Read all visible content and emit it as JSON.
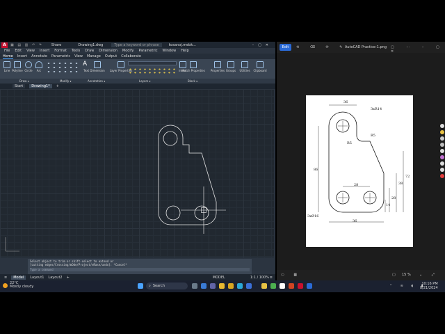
{
  "autocad": {
    "title_items": [
      "Share",
      "Drawing1.dwg",
      "Type a keyword or phrase",
      "kosanoj.mebk..."
    ],
    "menu": [
      "File",
      "Edit",
      "View",
      "Insert",
      "Format",
      "Tools",
      "Draw",
      "Dimension",
      "Modify",
      "Parametric",
      "Window",
      "Help"
    ],
    "ribbon_tabs": [
      "Home",
      "Insert",
      "Annotate",
      "Parametric",
      "View",
      "Manage",
      "Output",
      "Collaborate"
    ],
    "tools": [
      {
        "label": "Line",
        "icon": "line-icon"
      },
      {
        "label": "Polyline",
        "icon": "polyline-icon"
      },
      {
        "label": "Circle",
        "icon": "circle-icon"
      },
      {
        "label": "Arc",
        "icon": "arc-icon"
      },
      {
        "label": "Text",
        "icon": "text-icon"
      },
      {
        "label": "Dimension",
        "icon": "dimension-icon"
      },
      {
        "label": "Layer Properties",
        "icon": "layers-icon"
      },
      {
        "label": "Insert",
        "icon": "insert-block-icon"
      },
      {
        "label": "Match Properties",
        "icon": "match-properties-icon"
      },
      {
        "label": "Properties",
        "icon": "properties-icon"
      },
      {
        "label": "Groups",
        "icon": "groups-icon"
      },
      {
        "label": "Utilities",
        "icon": "utilities-icon"
      },
      {
        "label": "Clipboard",
        "icon": "clipboard-icon"
      }
    ],
    "panels": [
      "Draw ▾",
      "Modify ▾",
      "Annotation ▾",
      "Layers ▾",
      "Block ▾"
    ],
    "doc_tabs": [
      "Start",
      "Drawing1*"
    ],
    "command_history": [
      "Select object to trim or shift-select to extend or",
      "[cutting edges/Crossing/mOde/Project/eRase/undo]: *Cancel*"
    ],
    "command_placeholder": "Type a command",
    "layout_tabs": [
      "Model",
      "Layout1",
      "Layout2"
    ],
    "model_badge": "MODEL",
    "scale": "1:1 / 100%"
  },
  "viewer": {
    "edit_label": "Edit",
    "title": "AutoCAD Practice-1.png",
    "zoom": "15 %",
    "drawing": {
      "top_width": "36",
      "radius_top": "3xR14",
      "r5_right": "R5",
      "r5_left": "R5",
      "height_total": "86",
      "dim_28": "28",
      "dim_72": "72",
      "dim_38": "38",
      "dim_28_b": "28",
      "dim_14": "14",
      "holes": "3xØ16",
      "bottom_width": "36"
    }
  },
  "taskbar": {
    "weather_temp": "22°C",
    "weather_desc": "Mostly cloudy",
    "search_label": "Search",
    "time": "10:16 PM",
    "date": "8/21/2024"
  }
}
